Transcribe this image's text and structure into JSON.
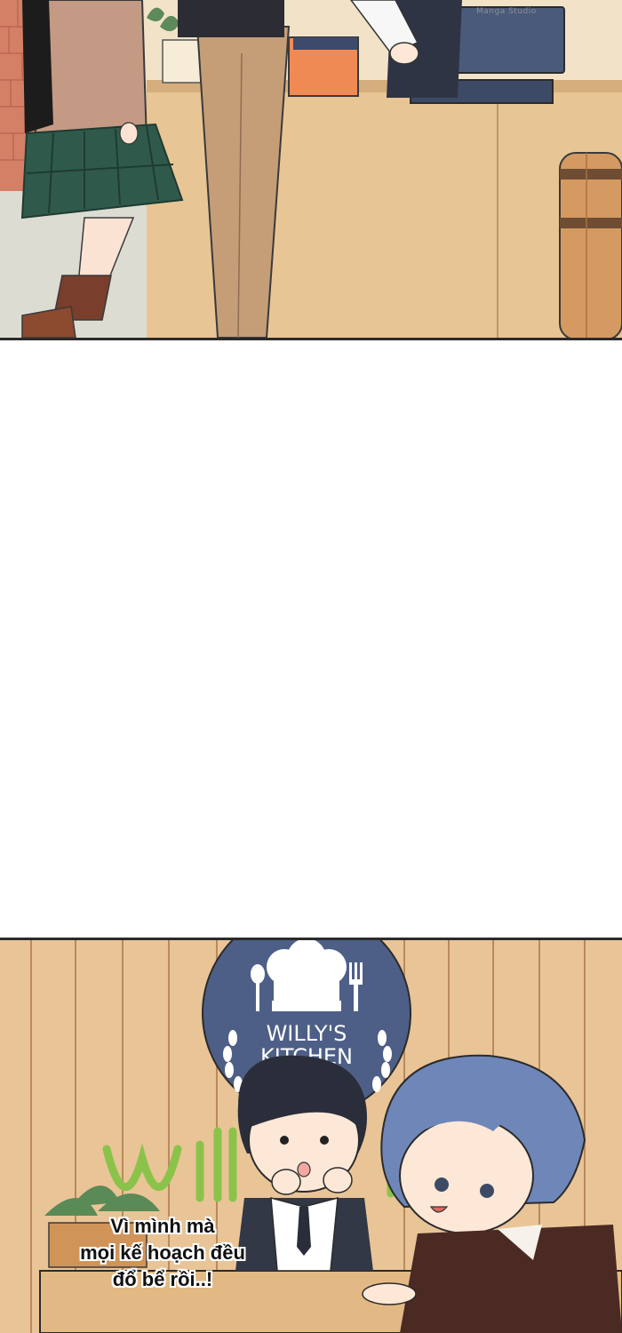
{
  "top_panel": {
    "watermark": "Manga Studio"
  },
  "bottom_panel": {
    "sign_line1": "WILLY'S",
    "sign_line2": "KITCHEN",
    "bubble": {
      "line1": "Vì mình mà",
      "line2": "mọi kế hoạch đều",
      "line3": "đổ bể rồi..!"
    }
  },
  "colors": {
    "wood": "#e9c497",
    "wood_dark": "#d3a877",
    "sign_navy": "#4d5f86",
    "hair_blue": "#6f86b9",
    "skirt_green": "#2f5a4b"
  }
}
